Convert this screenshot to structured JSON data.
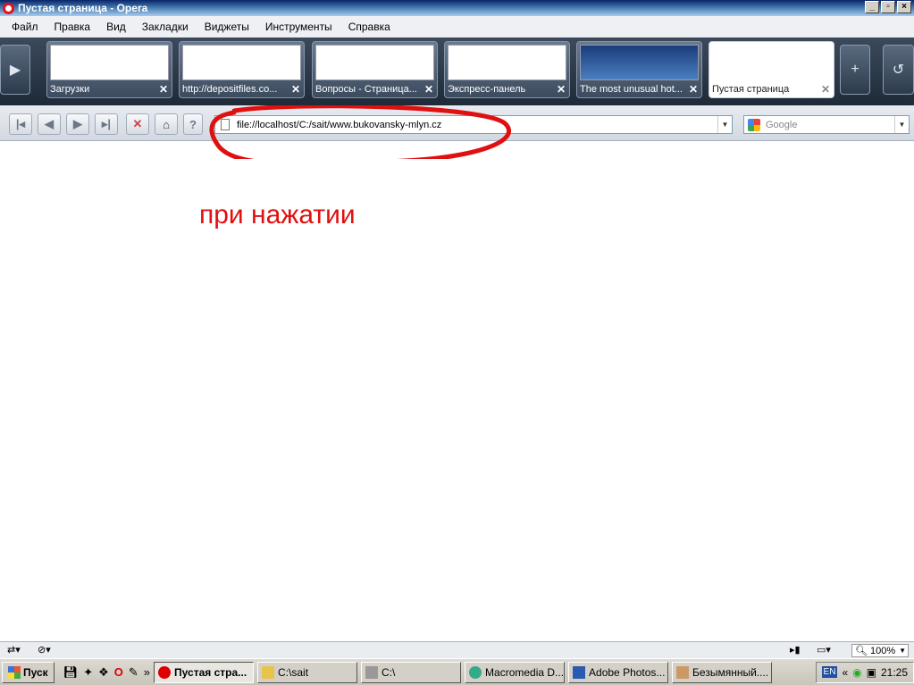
{
  "window": {
    "title": "Пустая страница - Opera"
  },
  "menu": [
    "Файл",
    "Правка",
    "Вид",
    "Закладки",
    "Виджеты",
    "Инструменты",
    "Справка"
  ],
  "tabs": [
    {
      "label": "Загрузки"
    },
    {
      "label": "http://depositfiles.co..."
    },
    {
      "label": "Вопросы - Страница..."
    },
    {
      "label": "Экспресс-панель"
    },
    {
      "label": "The most unusual hot..."
    },
    {
      "label": "Пустая страница"
    }
  ],
  "toolbar": {
    "address": "file://localhost/C:/sait/www.bukovansky-mlyn.cz",
    "search_placeholder": "Google"
  },
  "content": {
    "annotation": "при нажатии"
  },
  "status": {
    "zoom": "100%"
  },
  "taskbar": {
    "start": "Пуск",
    "tasks": [
      {
        "label": "Пустая стра...",
        "icon": "opera-icon"
      },
      {
        "label": "C:\\sait",
        "icon": "folder-icon"
      },
      {
        "label": "C:\\",
        "icon": "drive-icon"
      },
      {
        "label": "Macromedia D...",
        "icon": "dreamweaver-icon"
      },
      {
        "label": "Adobe Photos...",
        "icon": "photoshop-icon"
      },
      {
        "label": "Безымянный....",
        "icon": "paint-icon"
      }
    ],
    "lang": "EN",
    "clock": "21:25"
  },
  "colors": {
    "annotation": "#e01010",
    "tabbar": "#2c3a4c",
    "title_gradient_start": "#0a246a"
  }
}
